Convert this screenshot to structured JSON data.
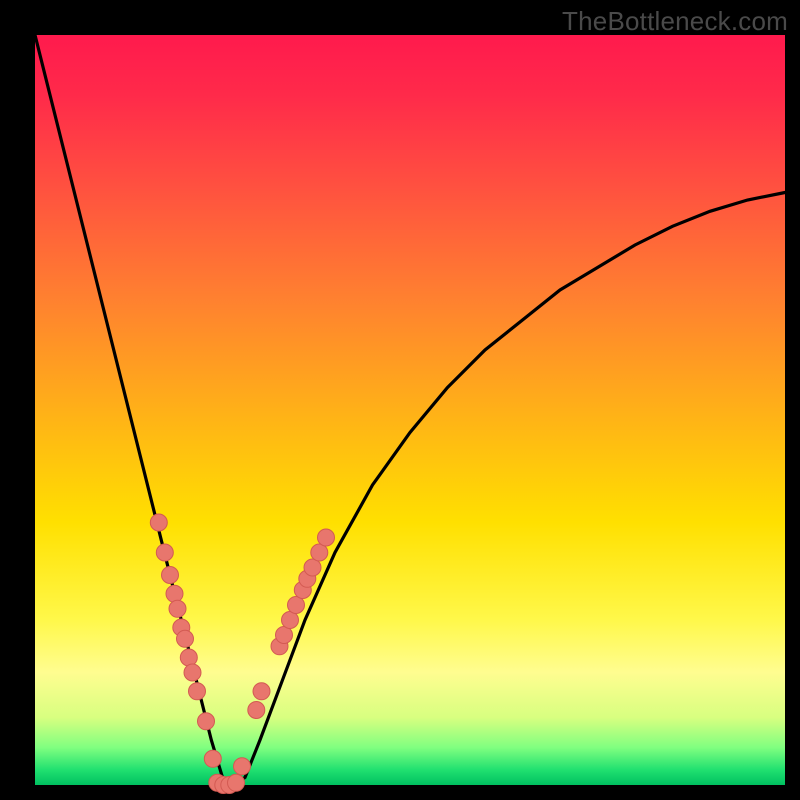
{
  "watermark": "TheBottleneck.com",
  "colors": {
    "background": "#000000",
    "curve": "#000000",
    "marker_fill": "#e8766d",
    "marker_stroke": "#d35a52"
  },
  "chart_data": {
    "type": "line",
    "title": "",
    "xlabel": "",
    "ylabel": "",
    "xlim": [
      0,
      100
    ],
    "ylim": [
      0,
      100
    ],
    "grid": false,
    "legend": false,
    "note": "V-shaped bottleneck curve; axes have no visible tick labels so x/y are in percent of plot extent. y≈0 is optimal (green band).",
    "series": [
      {
        "name": "curve",
        "x": [
          0,
          2,
          4,
          6,
          8,
          10,
          12,
          14,
          16,
          18,
          20,
          22,
          23.5,
          25,
          26.5,
          28,
          30,
          33,
          36,
          40,
          45,
          50,
          55,
          60,
          65,
          70,
          75,
          80,
          85,
          90,
          95,
          100
        ],
        "y": [
          100,
          92,
          84,
          76,
          68,
          60,
          52,
          44,
          36,
          28,
          20,
          12,
          6,
          1,
          0,
          1,
          6,
          14,
          22,
          31,
          40,
          47,
          53,
          58,
          62,
          66,
          69,
          72,
          74.5,
          76.5,
          78,
          79
        ]
      }
    ],
    "markers": [
      {
        "x": 16.5,
        "y": 35
      },
      {
        "x": 17.3,
        "y": 31
      },
      {
        "x": 18.0,
        "y": 28
      },
      {
        "x": 18.6,
        "y": 25.5
      },
      {
        "x": 19.0,
        "y": 23.5
      },
      {
        "x": 19.5,
        "y": 21
      },
      {
        "x": 20.0,
        "y": 19.5
      },
      {
        "x": 20.5,
        "y": 17
      },
      {
        "x": 21.0,
        "y": 15
      },
      {
        "x": 21.6,
        "y": 12.5
      },
      {
        "x": 22.8,
        "y": 8.5
      },
      {
        "x": 23.7,
        "y": 3.5
      },
      {
        "x": 24.3,
        "y": 0.3
      },
      {
        "x": 25.1,
        "y": 0.0
      },
      {
        "x": 25.9,
        "y": 0.0
      },
      {
        "x": 26.8,
        "y": 0.3
      },
      {
        "x": 27.6,
        "y": 2.5
      },
      {
        "x": 29.5,
        "y": 10
      },
      {
        "x": 30.2,
        "y": 12.5
      },
      {
        "x": 32.6,
        "y": 18.5
      },
      {
        "x": 33.2,
        "y": 20
      },
      {
        "x": 34.0,
        "y": 22
      },
      {
        "x": 34.8,
        "y": 24
      },
      {
        "x": 35.7,
        "y": 26
      },
      {
        "x": 36.3,
        "y": 27.5
      },
      {
        "x": 37.0,
        "y": 29
      },
      {
        "x": 37.9,
        "y": 31
      },
      {
        "x": 38.8,
        "y": 33
      }
    ]
  }
}
